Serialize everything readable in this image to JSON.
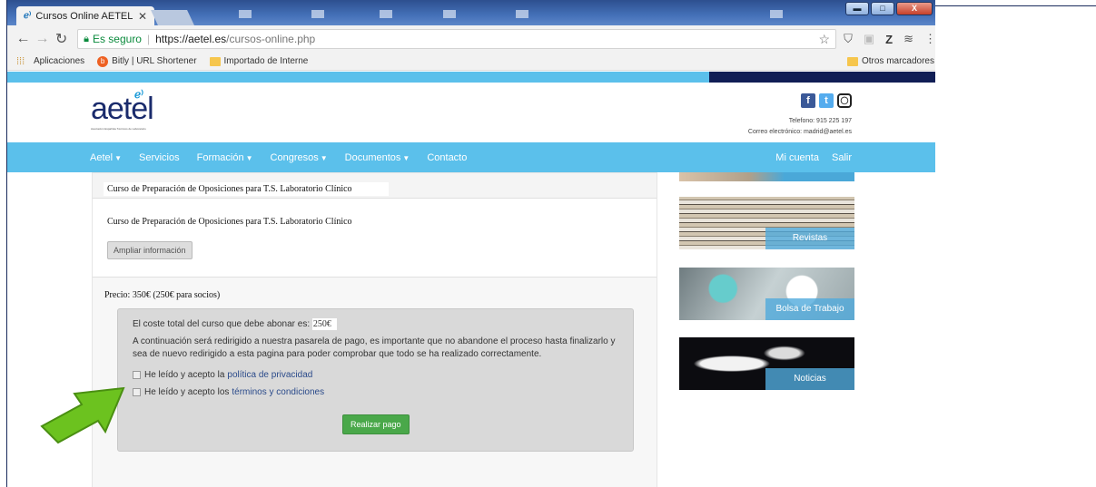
{
  "browser": {
    "tab_title": "Cursos Online AETEL",
    "tab_close": "✕",
    "window_controls": {
      "minimize": "▬",
      "maximize": "□",
      "close": "X"
    },
    "security_label": "Es seguro",
    "url_host": "https://aetel.es",
    "url_path": "/cursos-online.php",
    "bookmarks": [
      "Aplicaciones",
      "Bitly | URL Shortener",
      "Importado de Interne"
    ],
    "other_bookmarks": "Otros marcadores",
    "extension_letters": [
      "Z"
    ]
  },
  "site": {
    "logo_text": "aetel",
    "logo_tagline": "Asociación Española Técnicos de Laboratorio",
    "phone": "Telefono: 915 225 197",
    "email": "Correo electrónico: madrid@aetel.es",
    "menu": [
      {
        "label": "Aetel",
        "dropdown": true
      },
      {
        "label": "Servicios",
        "dropdown": false
      },
      {
        "label": "Formación",
        "dropdown": true
      },
      {
        "label": "Congresos",
        "dropdown": true
      },
      {
        "label": "Documentos",
        "dropdown": true
      },
      {
        "label": "Contacto",
        "dropdown": false
      }
    ],
    "menu_right": [
      "Mi cuenta",
      "Salir"
    ]
  },
  "course": {
    "header_title": "Curso de Preparación de Oposiciones para T.S. Laboratorio Clínico",
    "name": "Curso de Preparación de Oposiciones para T.S. Laboratorio Clínico",
    "more_info_button": "Ampliar información",
    "price": "Precio: 350€ (250€ para socios)"
  },
  "payment": {
    "total_label": "El coste total del curso que debe abonar es:",
    "total_value": "250€",
    "info_text": "A continuación será redirigido a nuestra pasarela de pago, es importante que no abandone el proceso hasta finalizarlo y sea de nuevo redirigido a esta pagina para poder comprobar que todo se ha realizado correctamente.",
    "privacy_prefix": "He leído y acepto la",
    "privacy_link": "política de privacidad",
    "terms_prefix": "He leído y acepto los",
    "terms_link": "términos y condiciones",
    "pay_button": "Realizar pago"
  },
  "sidebar": {
    "banners": [
      "Revistas",
      "Bolsa de Trabajo",
      "Noticias"
    ]
  },
  "colors": {
    "brand_blue": "#5bc0eb",
    "dark_navy": "#101e55",
    "pay_green": "#4aa84a",
    "arrow_green": "#6cc21f"
  }
}
